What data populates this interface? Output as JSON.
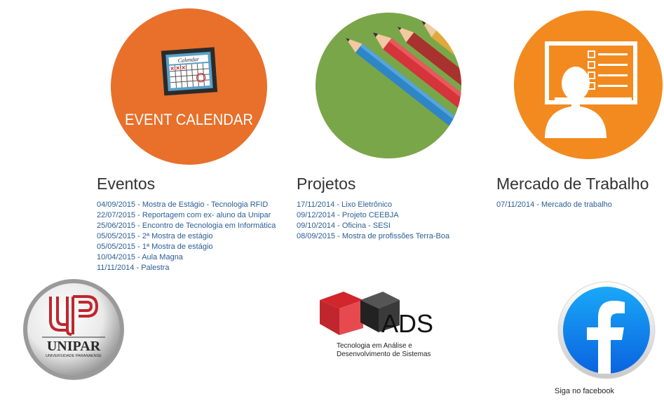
{
  "colors": {
    "link": "#2a5d95",
    "heading": "#333333",
    "event_orange": "#e8702a",
    "mercado_orange": "#f28a1f",
    "projetos_green": "#7aa64a",
    "facebook_blue": "#1877f2",
    "unipar_red": "#c0262d",
    "ads_red": "#d0262c"
  },
  "events_image": {
    "icon": "calendar-icon",
    "calendar_label": "Calendar",
    "caption": "EVENT CALENDAR"
  },
  "projetos_image": {
    "icon": "pencils-icon"
  },
  "mercado_image": {
    "icon": "checklist-presentation-icon"
  },
  "eventos": {
    "title": "Eventos",
    "items": [
      "04/09/2015 - Mostra de Estágio - Tecnologia RFID",
      "22/07/2015 - Reportagem com ex- aluno da Unipar",
      "25/06/2015 - Encontro de Tecnologia em Informática",
      "05/05/2015 - 2ª Mostra de estágio",
      "05/05/2015 - 1ª Mostra de estágio",
      "10/04/2015 - Aula Magna",
      "11/11/2014 - Palestra"
    ]
  },
  "projetos": {
    "title": "Projetos",
    "items": [
      "17/11/2014 - Lixo Eletrônico",
      "09/12/2014 - Projeto CEEBJA",
      "09/10/2014 - Oficina - SESI",
      "08/09/2015 - Mostra de profissões Terra-Boa"
    ]
  },
  "mercado": {
    "title": "Mercado de Trabalho",
    "items": [
      "07/11/2014 - Mercado de trabalho"
    ]
  },
  "unipar_logo": {
    "name": "UNIPAR",
    "subtitle": "UNIVERSIDADE PARANAENSE"
  },
  "ads_logo": {
    "name": "ADS",
    "line1": "Tecnologia em Análise e",
    "line2": "Desenvolvimento de Sistemas"
  },
  "facebook": {
    "icon": "facebook-icon",
    "caption": "Siga no facebook"
  }
}
